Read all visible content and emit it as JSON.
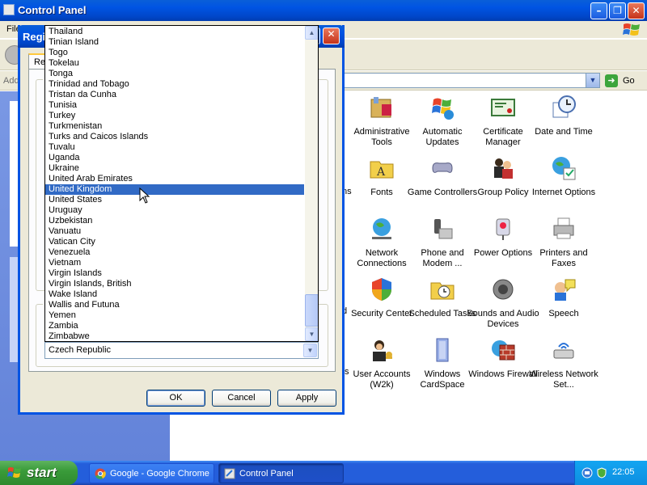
{
  "control_panel": {
    "title": "Control Panel",
    "menu_partial": "File",
    "address_partial": "Address",
    "go_label": "Go",
    "partial_labels": [
      "ns",
      "d",
      "ts"
    ],
    "icons": [
      {
        "label": "Administrative Tools",
        "icon": "admin-tools-icon"
      },
      {
        "label": "Automatic Updates",
        "icon": "automatic-updates-icon"
      },
      {
        "label": "Certificate Manager",
        "icon": "certificate-manager-icon"
      },
      {
        "label": "Date and Time",
        "icon": "date-time-icon"
      },
      {
        "label": "Fonts",
        "icon": "fonts-icon"
      },
      {
        "label": "Game Controllers",
        "icon": "game-controllers-icon"
      },
      {
        "label": "Group Policy",
        "icon": "group-policy-icon"
      },
      {
        "label": "Internet Options",
        "icon": "internet-options-icon"
      },
      {
        "label": "Network Connections",
        "icon": "network-connections-icon"
      },
      {
        "label": "Phone and Modem ...",
        "icon": "phone-modem-icon"
      },
      {
        "label": "Power Options",
        "icon": "power-options-icon"
      },
      {
        "label": "Printers and Faxes",
        "icon": "printers-faxes-icon"
      },
      {
        "label": "Security Center",
        "icon": "security-center-icon"
      },
      {
        "label": "Scheduled Tasks",
        "icon": "scheduled-tasks-icon"
      },
      {
        "label": "Sounds and Audio Devices",
        "icon": "sounds-audio-icon"
      },
      {
        "label": "Speech",
        "icon": "speech-icon"
      },
      {
        "label": "User Accounts (W2k)",
        "icon": "user-accounts-icon"
      },
      {
        "label": "Windows CardSpace",
        "icon": "cardspace-icon"
      },
      {
        "label": "Windows Firewall",
        "icon": "firewall-icon"
      },
      {
        "label": "Wireless Network Set...",
        "icon": "wireless-network-icon"
      }
    ]
  },
  "dialog": {
    "title_partial": "Regi",
    "tab_partial": "Reg",
    "group_letters": [
      "S",
      "L"
    ],
    "buttons": {
      "ok": "OK",
      "cancel": "Cancel",
      "apply": "Apply"
    },
    "country_list": [
      "Thailand",
      "Tinian Island",
      "Togo",
      "Tokelau",
      "Tonga",
      "Trinidad and Tobago",
      "Tristan da Cunha",
      "Tunisia",
      "Turkey",
      "Turkmenistan",
      "Turks and Caicos Islands",
      "Tuvalu",
      "Uganda",
      "Ukraine",
      "United Arab Emirates",
      "United Kingdom",
      "United States",
      "Uruguay",
      "Uzbekistan",
      "Vanuatu",
      "Vatican City",
      "Venezuela",
      "Vietnam",
      "Virgin Islands",
      "Virgin Islands, British",
      "Wake Island",
      "Wallis and Futuna",
      "Yemen",
      "Zambia",
      "Zimbabwe"
    ],
    "highlighted_item": "United Kingdom",
    "selected_value": "Czech Republic"
  },
  "taskbar": {
    "start_label": "start",
    "tasks": [
      {
        "label": "Google - Google Chrome",
        "icon": "chrome-icon"
      },
      {
        "label": "Control Panel",
        "icon": "control-panel-icon"
      }
    ],
    "clock": "22:05"
  },
  "colors": {
    "titlebar_blue": "#0054e3",
    "selection_blue": "#316ac5",
    "start_green": "#3a9c3a",
    "dialog_face": "#ece9d8"
  }
}
